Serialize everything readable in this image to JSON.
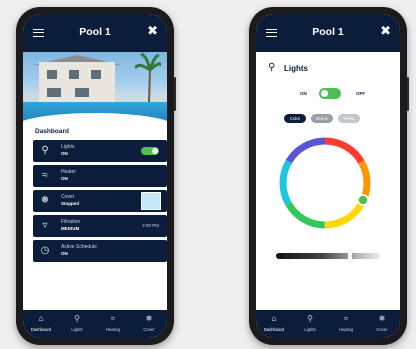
{
  "left_phone": {
    "header": {
      "title": "Pool 1",
      "menu_icon": "hamburger-icon",
      "tools_icon": "tools-icon"
    },
    "dashboard_title": "Dashboard",
    "cards": [
      {
        "label": "Lights",
        "status": "ON",
        "icon": "bulb-icon"
      },
      {
        "label": "Heater",
        "status": "ON",
        "icon": "heater-icon"
      },
      {
        "label": "Cover",
        "status": "Stopped",
        "icon": "cover-icon"
      },
      {
        "label": "Filtration",
        "status": "MEDIUM",
        "time": "2:00 PM",
        "icon": "filtration-icon"
      },
      {
        "label": "Active Schedule",
        "status": "ON",
        "icon": "clock-icon"
      }
    ],
    "nav": [
      "Dashboard",
      "Lights",
      "Heating",
      "Cover"
    ]
  },
  "right_phone": {
    "header": {
      "title": "Pool 1"
    },
    "title": "Lights",
    "toggle": {
      "on_label": "ON",
      "off_label": "OFF"
    },
    "tabs": [
      "Color",
      "Scene",
      "White"
    ],
    "nav": [
      "Dashboard",
      "Lights",
      "Heating",
      "Cover"
    ]
  },
  "colors": {
    "navy": "#0c1d3b",
    "green": "#4fbf55",
    "pool_blue": "#1f7fbf"
  }
}
